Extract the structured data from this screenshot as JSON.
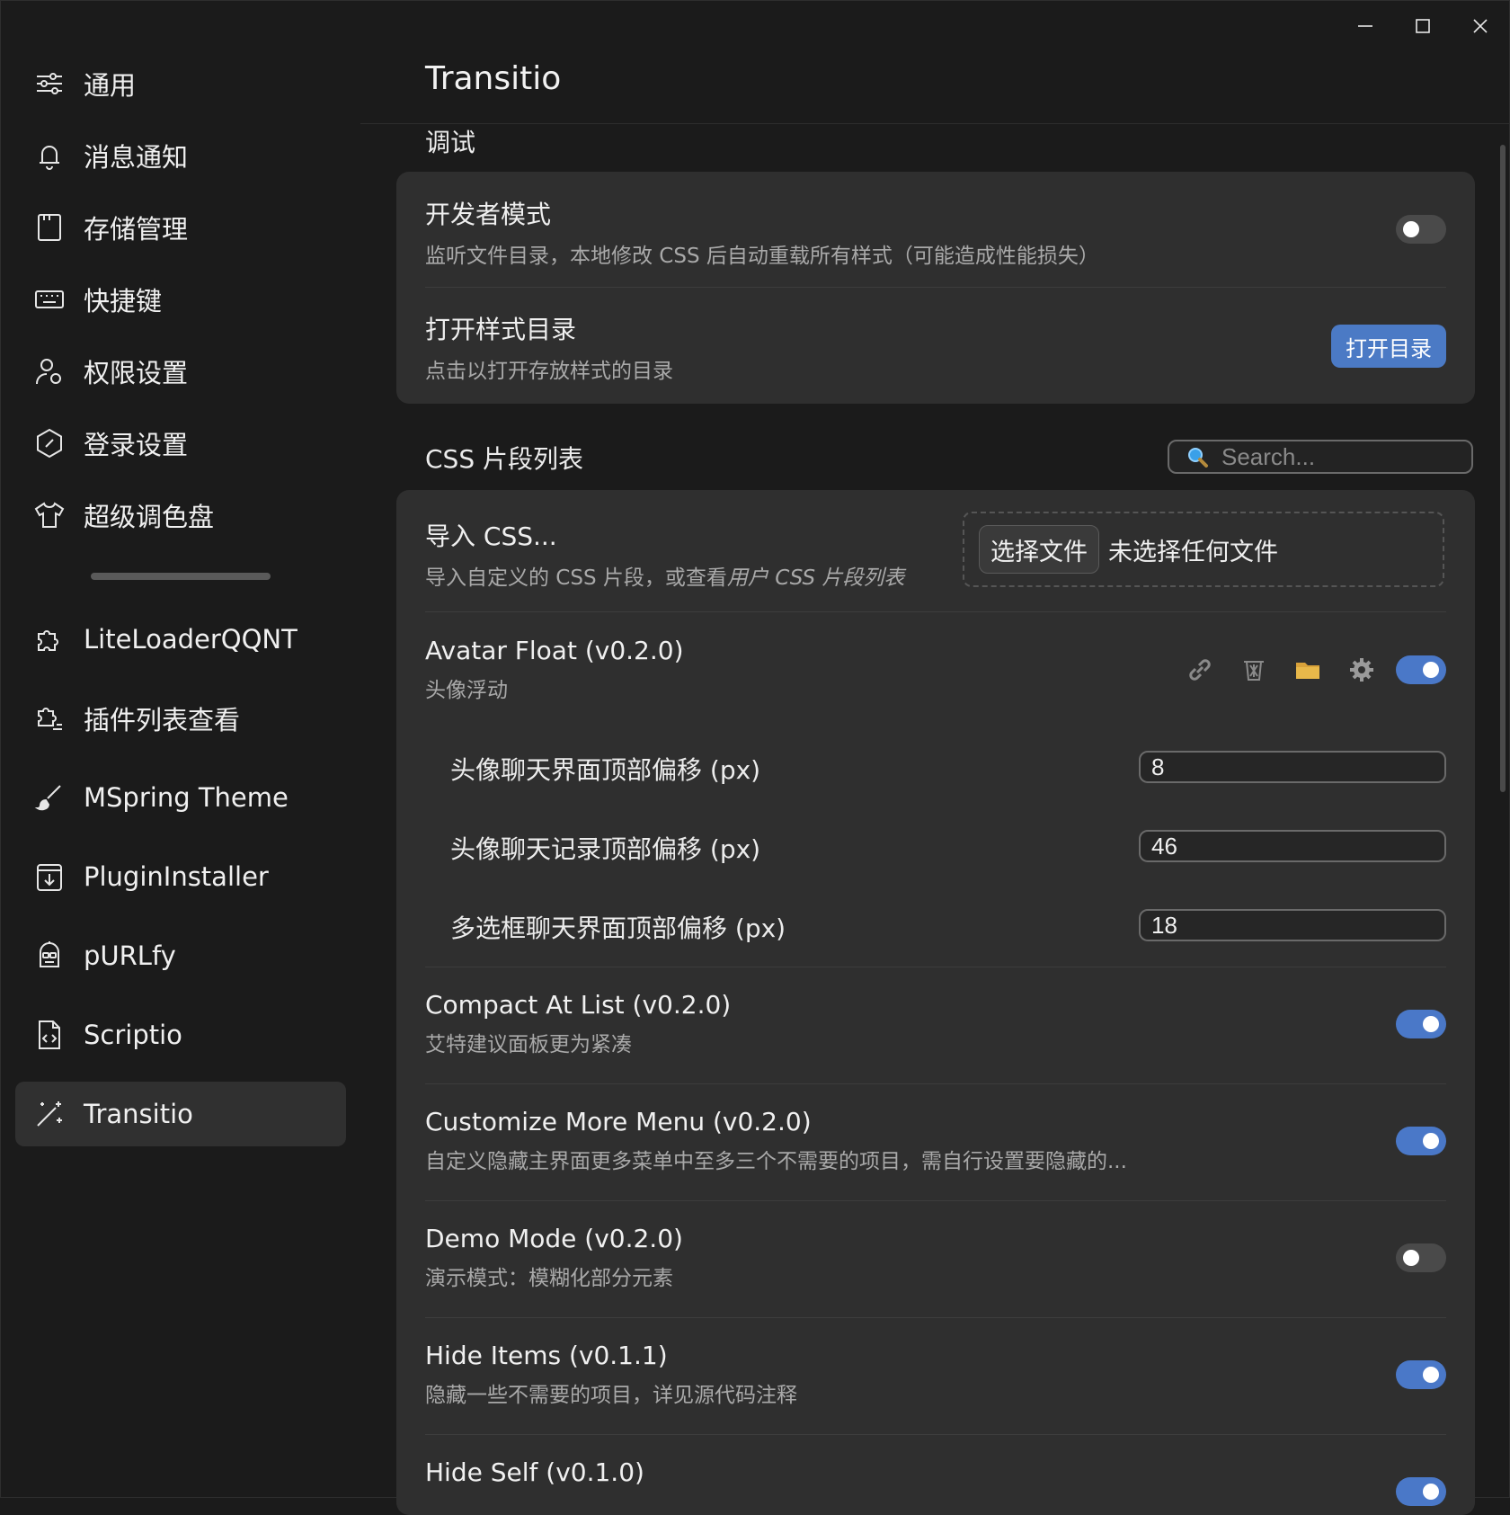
{
  "window": {
    "controls": [
      "minimize-icon",
      "maximize-icon",
      "close-icon"
    ]
  },
  "sidebar": {
    "items": [
      {
        "label": "通用",
        "icon": "sliders-icon"
      },
      {
        "label": "消息通知",
        "icon": "bell-icon"
      },
      {
        "label": "存储管理",
        "icon": "storage-icon"
      },
      {
        "label": "快捷键",
        "icon": "keyboard-icon"
      },
      {
        "label": "权限设置",
        "icon": "user-lock-icon"
      },
      {
        "label": "登录设置",
        "icon": "hexagon-icon"
      },
      {
        "label": "超级调色盘",
        "icon": "shirt-icon"
      }
    ],
    "plugins": [
      {
        "label": "LiteLoaderQQNT",
        "icon": "puzzle-icon"
      },
      {
        "label": "插件列表查看",
        "icon": "puzzle-list-icon"
      },
      {
        "label": "MSpring Theme",
        "icon": "brush-icon"
      },
      {
        "label": "PluginInstaller",
        "icon": "download-box-icon"
      },
      {
        "label": "pURLfy",
        "icon": "robot-icon"
      },
      {
        "label": "Scriptio",
        "icon": "code-file-icon"
      },
      {
        "label": "Transitio",
        "icon": "magic-wand-icon",
        "active": true
      }
    ]
  },
  "main": {
    "title": "Transitio",
    "debug": {
      "section_title": "调试",
      "dev_mode": {
        "title": "开发者模式",
        "desc": "监听文件目录，本地修改 CSS 后自动重载所有样式（可能造成性能损失）",
        "enabled": false
      },
      "open_dir": {
        "title": "打开样式目录",
        "desc": "点击以打开存放样式的目录",
        "button": "打开目录"
      }
    },
    "snippets": {
      "section_title": "CSS 片段列表",
      "search_placeholder": "Search...",
      "import": {
        "title": "导入 CSS...",
        "desc_prefix": "导入自定义的 CSS 片段，或查看",
        "desc_link": "用户 CSS 片段列表",
        "file_button": "选择文件",
        "file_status": "未选择任何文件"
      },
      "avatar_float": {
        "title": "Avatar Float (v0.2.0)",
        "desc": "头像浮动",
        "enabled": true,
        "actions": [
          "link-icon",
          "trash-icon",
          "folder-icon",
          "gear-icon"
        ],
        "params": [
          {
            "label": "头像聊天界面顶部偏移 (px)",
            "value": "8"
          },
          {
            "label": "头像聊天记录顶部偏移 (px)",
            "value": "46"
          },
          {
            "label": "多选框聊天界面顶部偏移 (px)",
            "value": "18"
          }
        ]
      },
      "items": [
        {
          "title": "Compact At List (v0.2.0)",
          "desc": "艾特建议面板更为紧凑",
          "enabled": true
        },
        {
          "title": "Customize More Menu (v0.2.0)",
          "desc": "自定义隐藏主界面更多菜单中至多三个不需要的项目，需自行设置要隐藏的...",
          "enabled": true
        },
        {
          "title": "Demo Mode (v0.2.0)",
          "desc": "演示模式：模糊化部分元素",
          "enabled": false
        },
        {
          "title": "Hide Items (v0.1.1)",
          "desc": "隐藏一些不需要的项目，详见源代码注释",
          "enabled": true
        },
        {
          "title": "Hide Self (v0.1.0)",
          "desc": "",
          "enabled": true
        }
      ]
    }
  },
  "colors": {
    "accent": "#4b7ac5",
    "toggle_on": "#4a78c8",
    "background": "#1b1b1b",
    "card": "#2f2f2f"
  }
}
